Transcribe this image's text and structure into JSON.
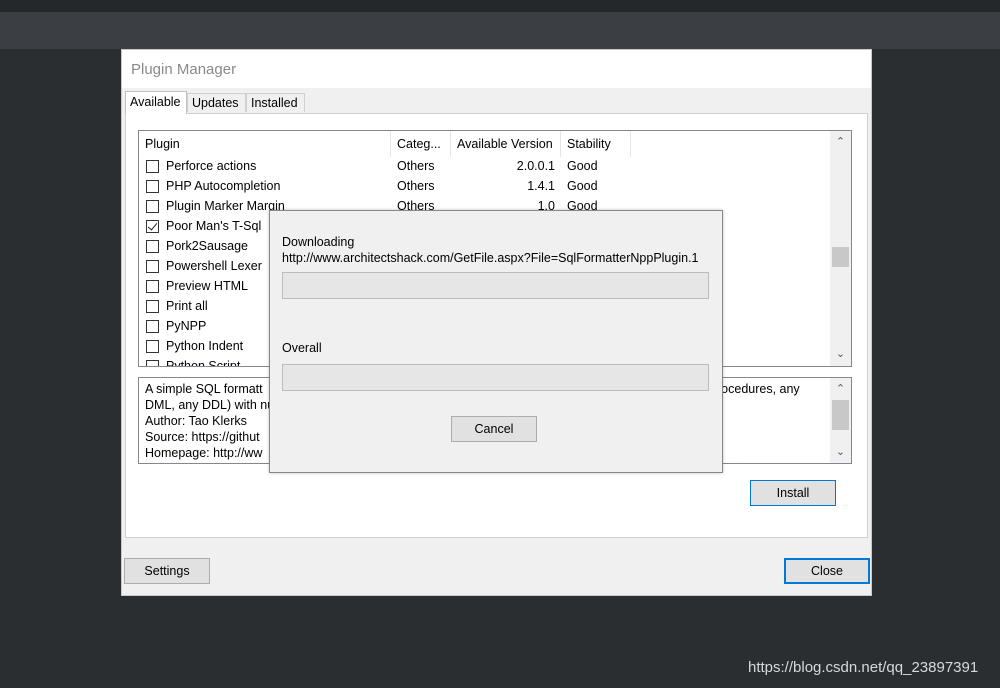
{
  "window": {
    "title": "Plugin Manager"
  },
  "tabs": [
    {
      "label": "Available",
      "active": true
    },
    {
      "label": "Updates",
      "active": false
    },
    {
      "label": "Installed",
      "active": false
    }
  ],
  "list": {
    "columns": [
      "Plugin",
      "Categ...",
      "Available Version",
      "Stability"
    ],
    "rows": [
      {
        "checked": false,
        "name": "Perforce actions",
        "category": "Others",
        "version": "2.0.0.1",
        "stability": "Good"
      },
      {
        "checked": false,
        "name": "PHP Autocompletion",
        "category": "Others",
        "version": "1.4.1",
        "stability": "Good"
      },
      {
        "checked": false,
        "name": "Plugin Marker Margin",
        "category": "Others",
        "version": "1.0",
        "stability": "Good"
      },
      {
        "checked": true,
        "name": "Poor Man's T-Sql",
        "category": "",
        "version": "",
        "stability": ""
      },
      {
        "checked": false,
        "name": "Pork2Sausage",
        "category": "",
        "version": "",
        "stability": ""
      },
      {
        "checked": false,
        "name": "Powershell Lexer",
        "category": "",
        "version": "",
        "stability": ""
      },
      {
        "checked": false,
        "name": "Preview HTML",
        "category": "",
        "version": "",
        "stability": ""
      },
      {
        "checked": false,
        "name": "Print all",
        "category": "",
        "version": "",
        "stability": ""
      },
      {
        "checked": false,
        "name": "PyNPP",
        "category": "",
        "version": "",
        "stability": ""
      },
      {
        "checked": false,
        "name": "Python Indent",
        "category": "",
        "version": "",
        "stability": ""
      },
      {
        "checked": false,
        "name": "Python Script",
        "category": "",
        "version": "",
        "stability": ""
      }
    ],
    "scroll_position": 0.55
  },
  "description": {
    "lines": [
      {
        "left": "A simple SQL formatt",
        "right": "rocedures, any"
      },
      {
        "left": "DML, any DDL) with nu",
        "right": ""
      },
      {
        "left": "Author: Tao Klerks",
        "right": ""
      },
      {
        "left": "Source: https://githut",
        "right": ""
      },
      {
        "left": "Homepage: http://ww",
        "right": ""
      }
    ]
  },
  "buttons": {
    "install": "Install",
    "settings": "Settings",
    "close": "Close"
  },
  "dialog": {
    "downloading_label": "Downloading",
    "url": "http://www.architectshack.com/GetFile.aspx?File=SqlFormatterNppPlugin.1",
    "download_progress": 0,
    "overall_label": "Overall",
    "overall_progress": 0,
    "cancel_label": "Cancel"
  },
  "watermark": "https://blog.csdn.net/qq_23897391",
  "colors": {
    "accent": "#0078d7",
    "backdrop": "#2b2e31",
    "progress_fill": "#06b025"
  }
}
